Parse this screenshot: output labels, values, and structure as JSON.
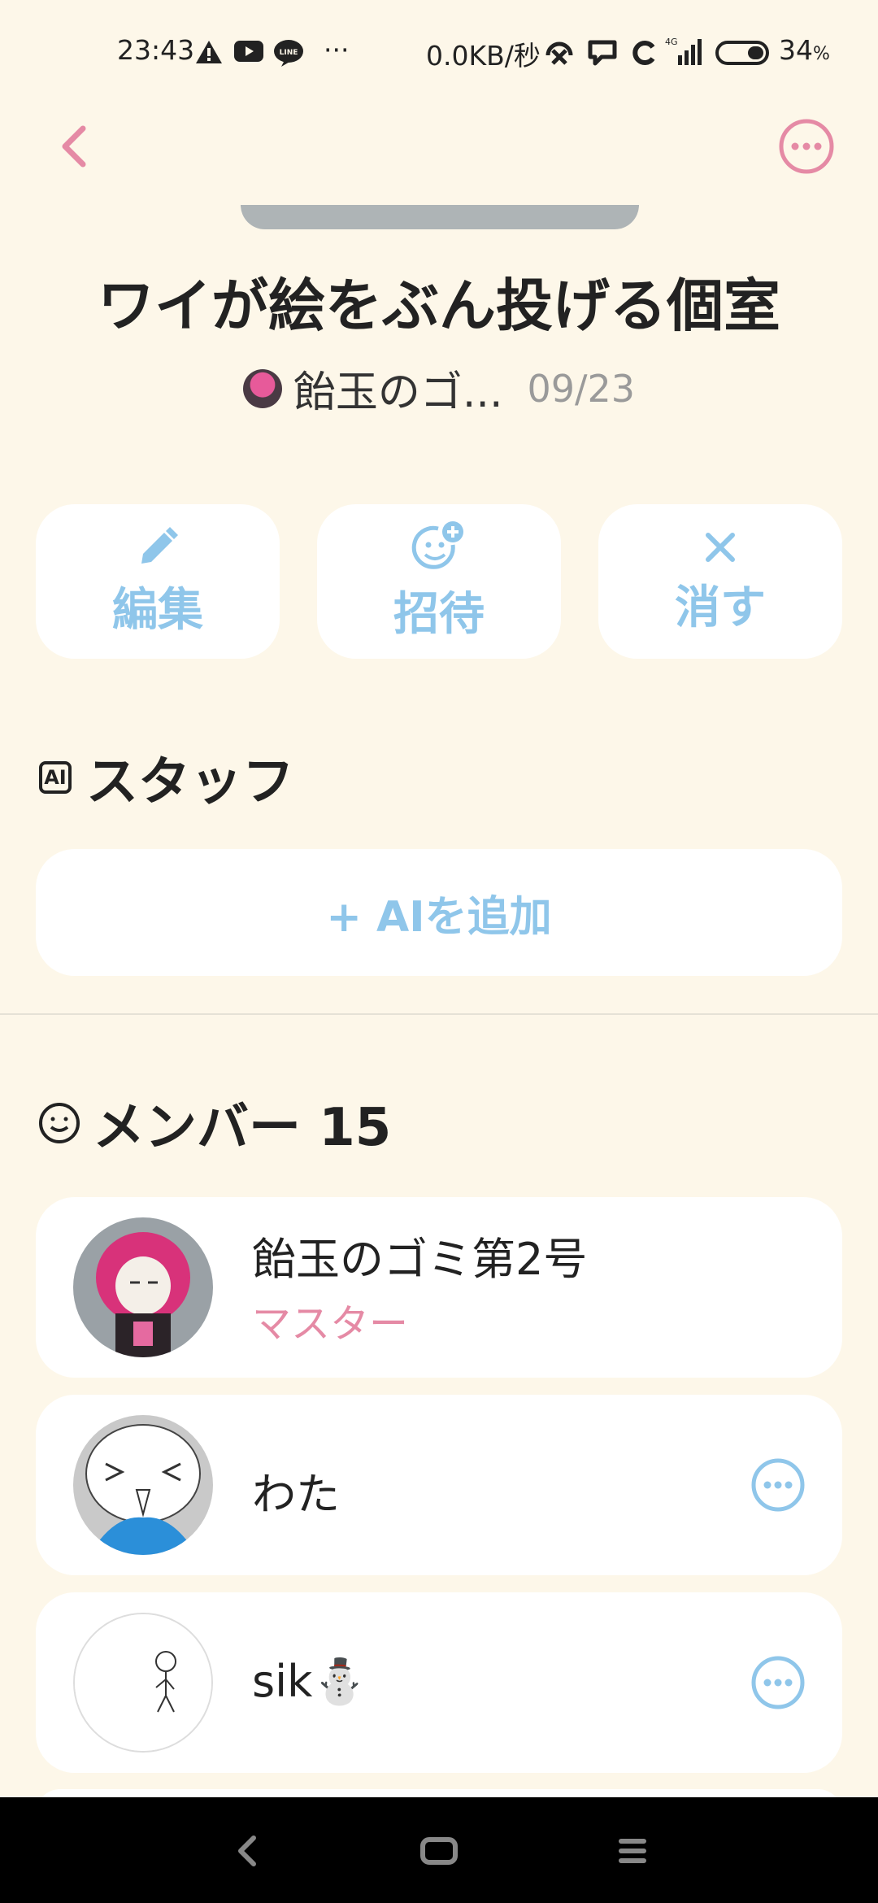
{
  "status_bar": {
    "time": "23:43",
    "net_speed": "0.0KB/秒",
    "network": "4G",
    "battery": "34",
    "battery_unit": "%"
  },
  "room": {
    "title": "ワイが絵をぶん投げる個室",
    "owner_name": "飴玉のゴ...",
    "date": "09/23"
  },
  "actions": {
    "edit": "編集",
    "invite": "招待",
    "close": "消す"
  },
  "staff": {
    "badge": "AI",
    "title": "スタッフ",
    "add_button": "+ AIを追加"
  },
  "members": {
    "title": "メンバー 15",
    "list": [
      {
        "name": "飴玉のゴミ第2号",
        "role": "マスター"
      },
      {
        "name": "わた"
      },
      {
        "name": "sik⁠⛄"
      }
    ]
  },
  "colors": {
    "background": "#fdf7e9",
    "accent_blue": "#8fc6ea",
    "accent_pink": "#e58aa5"
  }
}
